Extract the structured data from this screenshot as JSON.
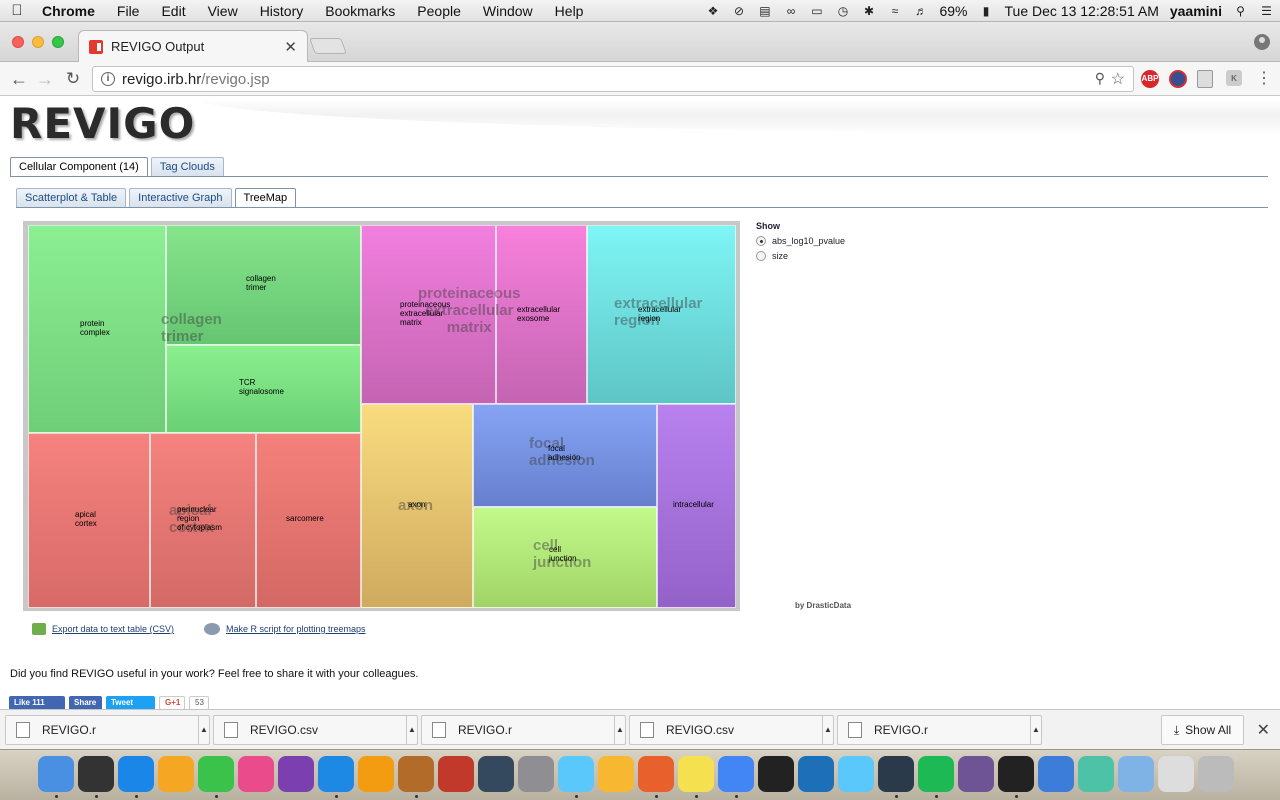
{
  "menubar": {
    "app": "Chrome",
    "items": [
      "File",
      "Edit",
      "View",
      "History",
      "Bookmarks",
      "People",
      "Window",
      "Help"
    ],
    "battery": "69%",
    "datetime": "Tue Dec 13  12:28:51 AM",
    "user": "yaamini"
  },
  "browser": {
    "tab_title": "REVIGO Output",
    "url_host": "revigo.irb.hr",
    "url_path": "/revigo.jsp"
  },
  "page": {
    "logo": "REVIGO",
    "top_tabs": [
      "Cellular Component (14)",
      "Tag Clouds"
    ],
    "sub_tabs": [
      "Scatterplot & Table",
      "Interactive Graph",
      "TreeMap"
    ],
    "show_panel": {
      "title": "Show",
      "options": [
        "abs_log10_pvalue",
        "size"
      ],
      "selected": "abs_log10_pvalue"
    },
    "credit": "by DrasticData",
    "export_csv": "Export data to text table (CSV)",
    "export_r": "Make R script for plotting treemaps",
    "share_text": "Did you find REVIGO useful in your work? Feel free to share it with your colleagues.",
    "social": {
      "like": "Like 111",
      "share": "Share",
      "tweet": "Tweet",
      "gplus": "G+1",
      "gcount": "53"
    }
  },
  "treemap": {
    "groups": [
      {
        "name": "collagen trimer",
        "color": "#86e08a",
        "terms": [
          "protein complex",
          "collagen trimer",
          "TCR signalosome"
        ]
      },
      {
        "name": "proteinaceous extracellular matrix",
        "color": "#ea78cf",
        "terms": [
          "proteinaceous extracellular matrix",
          "extracellular exosome"
        ]
      },
      {
        "name": "extracellular region",
        "color": "#7eeaea",
        "terms": [
          "extracellular region"
        ]
      },
      {
        "name": "apical cortex",
        "color": "#ee7e78",
        "terms": [
          "apical cortex",
          "perinuclear region of cytoplasm",
          "sarcomere"
        ]
      },
      {
        "name": "axon",
        "color": "#f1cd74",
        "terms": [
          "axon"
        ]
      },
      {
        "name": "focal adhesion",
        "color": "#7c96e6",
        "terms": [
          "focal adhesion"
        ]
      },
      {
        "name": "cell junction",
        "color": "#b8ec78",
        "terms": [
          "cell junction"
        ]
      },
      {
        "name": "intracellular",
        "color": "#ad72de",
        "terms": [
          "intracellular"
        ]
      }
    ],
    "cells": {
      "protein_complex": "protein\ncomplex",
      "collagen_trimer": "collagen\ntrimer",
      "tcr": "TCR\nsignalosome",
      "proteinaceous": "proteinaceous\nextracellular\nmatrix",
      "exosome": "extracellular\nexosome",
      "extracellular_region": "extracellular\nregion",
      "apical_cortex": "apical\ncortex",
      "perinuclear": "perinuclear\nregion\nof cytoplasm",
      "sarcomere": "sarcomere",
      "axon": "axon",
      "focal_adhesion": "focal\nadhesion",
      "cell_junction": "cell\njunction",
      "intracellular": "intracellular"
    },
    "group_labels": {
      "collagen": "collagen\ntrimer",
      "proteinaceous": "proteinaceous\nextracellular\nmatrix",
      "extracellular_region": "extracellular\nregion",
      "apical": "apical\ncortex",
      "axon": "axon",
      "focal": "focal\nadhesion",
      "junction": "cell\njunction"
    }
  },
  "downloads": {
    "items": [
      "REVIGO.r",
      "REVIGO.csv",
      "REVIGO.r",
      "REVIGO.csv",
      "REVIGO.r"
    ],
    "show_all": "Show All"
  },
  "dock": {
    "apps": [
      "Finder",
      "Dashboard",
      "App Store",
      "Photos",
      "FaceTime",
      "iTunes",
      "iMovie",
      "Safari",
      "iBooks",
      "GarageBand",
      "Photo Booth",
      "QuickTime",
      "System Preferences",
      "Preview",
      "Sketch",
      "Firefox",
      "Stickies",
      "Chrome",
      "Poker",
      "Word",
      "Messages",
      "Lightroom",
      "Spotify",
      "GitHub",
      "Terminal",
      "Screen",
      "Cloud",
      "Folder",
      "Document",
      "Trash"
    ]
  }
}
